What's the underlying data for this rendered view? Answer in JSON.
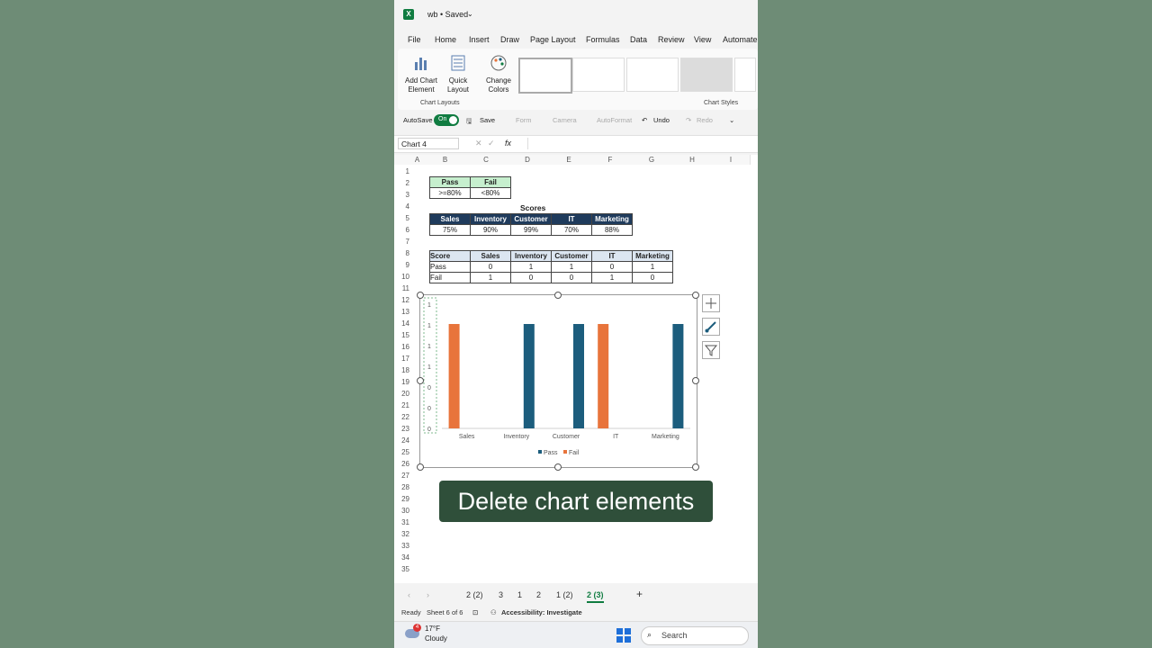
{
  "colors": {
    "pass": "#1c5d7d",
    "fail": "#e8743b",
    "excel_green": "#107c41",
    "caption_bg": "#2f4f3a"
  },
  "titlebar": {
    "title": "wb • Saved"
  },
  "menu": [
    "File",
    "Home",
    "Insert",
    "Draw",
    "Page Layout",
    "Formulas",
    "Data",
    "Review",
    "View",
    "Automate"
  ],
  "ribbon": {
    "add_chart_element": [
      "Add Chart",
      "Element"
    ],
    "quick_layout": [
      "Quick",
      "Layout"
    ],
    "change_colors": [
      "Change",
      "Colors"
    ],
    "chart_layouts_label": "Chart Layouts",
    "chart_styles_label": "Chart Styles"
  },
  "qat": {
    "autosave": "AutoSave",
    "toggle": "On",
    "save": "Save",
    "form": "Form",
    "camera": "Camera",
    "autoformat": "AutoFormat",
    "undo": "Undo",
    "redo": "Redo"
  },
  "formula_bar": {
    "name_box": "Chart 4",
    "fx": "fx"
  },
  "columns": [
    "A",
    "B",
    "C",
    "D",
    "E",
    "F",
    "G",
    "H",
    "I"
  ],
  "rows": [
    "1",
    "2",
    "3",
    "4",
    "5",
    "6",
    "7",
    "8",
    "9",
    "10",
    "11",
    "12",
    "13",
    "14",
    "15",
    "16",
    "17",
    "18",
    "19",
    "20",
    "21",
    "22",
    "23",
    "24",
    "25",
    "26",
    "27",
    "28",
    "29",
    "30",
    "31",
    "32",
    "33",
    "34",
    "35"
  ],
  "legend_table": {
    "headers": [
      "Pass",
      "Fail"
    ],
    "values": [
      ">=80%",
      "<80%"
    ]
  },
  "scores": {
    "title": "Scores",
    "headers": [
      "Sales",
      "Inventory",
      "Customer",
      "IT",
      "Marketing"
    ],
    "values": [
      "75%",
      "90%",
      "99%",
      "70%",
      "88%"
    ]
  },
  "result_table": {
    "headers": [
      "Score",
      "Sales",
      "Inventory",
      "Customer",
      "IT",
      "Marketing"
    ],
    "rows": [
      [
        "Pass",
        "0",
        "1",
        "1",
        "0",
        "1"
      ],
      [
        "Fail",
        "1",
        "0",
        "0",
        "1",
        "0"
      ]
    ]
  },
  "chart_data": {
    "type": "bar",
    "categories": [
      "Sales",
      "Inventory",
      "Customer",
      "IT",
      "Marketing"
    ],
    "series": [
      {
        "name": "Pass",
        "values": [
          0,
          1,
          1,
          0,
          1
        ]
      },
      {
        "name": "Fail",
        "values": [
          1,
          0,
          0,
          1,
          0
        ]
      }
    ],
    "y_tick_labels": [
      "1",
      "1",
      "1",
      "1",
      "0",
      "0",
      "0"
    ],
    "ylim": [
      0,
      1
    ],
    "legend": "bottom",
    "grid": false
  },
  "caption": "Delete chart elements",
  "sheet_tabs": [
    "2 (2)",
    "3",
    "1",
    "2",
    "1 (2)",
    "2 (3)"
  ],
  "active_tab": "2 (3)",
  "status": {
    "ready": "Ready",
    "sheet": "Sheet 6 of 6",
    "accessibility": "Accessibility: Investigate"
  },
  "taskbar": {
    "temp": "17°F",
    "condition": "Cloudy",
    "badge": "4",
    "search": "Search"
  }
}
